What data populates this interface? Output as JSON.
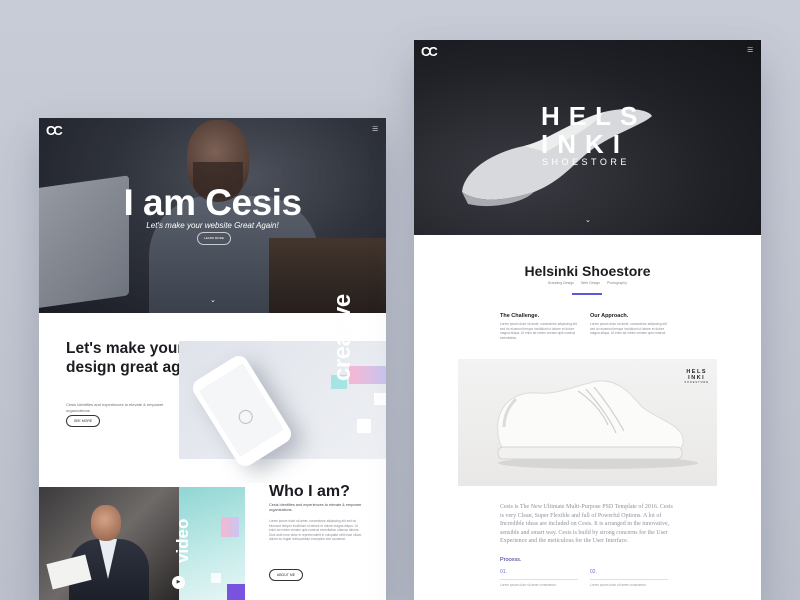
{
  "left_page": {
    "logo": "CC",
    "hero": {
      "title": "I am Cesis",
      "subtitle": "Let's make your website Great Again!",
      "button": "LEARN MORE"
    },
    "section_design": {
      "heading": "Let's make your design great again",
      "description": "Cesis Identifies and experiences to elevate & empower organizations",
      "button": "SEE MORE",
      "creative_word": "creative"
    },
    "section_about": {
      "video_word": "video",
      "heading": "Who I am?",
      "lead": "Cesis Identifies and experiences to elevate & empower organizations.",
      "body": "Lorem ipsum dolor sit amet, consectetur adipiscing elit sed do eiusmod tempor incididunt ut labore et dolore magna aliqua. Ut enim ad minim veniam quis nostrud exercitation ullamco laboris. Duis aute irure dolor in reprehenderit in voluptate velit esse cillum dolore eu fugiat nulla pariatur excepteur sint occaecat.",
      "button": "ABOUT ME"
    }
  },
  "right_page": {
    "logo": "CC",
    "hero": {
      "title_line1": "HELS",
      "title_line2": "INKI",
      "tagline": "SHOESTORE"
    },
    "project": {
      "title": "Helsinki Shoestore",
      "tags": [
        "Branding Design",
        "Web Design",
        "Photography"
      ],
      "challenge_title": "The Challenge.",
      "challenge_text": "Lorem ipsum dolor sit amet, consectetur adipiscing elit sed do eiusmod tempor incididunt ut labore et dolore magna aliqua. Ut enim ad minim veniam quis nostrud exercitation.",
      "approach_title": "Our Approach.",
      "approach_text": "Lorem ipsum dolor sit amet, consectetur adipiscing elit sed do eiusmod tempor incididunt ut labore et dolore magna aliqua. Ut enim ad minim veniam quis nostrud.",
      "mini_logo_line1": "HELS",
      "mini_logo_line2": "INKI",
      "mini_logo_tag": "SHOESTORE",
      "paragraph": "Cesis is The New Ultimate Multi-Purpose PSD Template of 2016. Cesis is very Clean, Super Flexible and full of Powerful Options. A lot of Incredible ideas are included on Cesis. It is arranged in the innovative, sensible and smart way. Cesis is build by strong concerns for the User Experience and the meticulous for the User Interface.",
      "process_title": "Process.",
      "process_steps": [
        {
          "num": "01.",
          "text": "Lorem ipsum dolor sit amet consectetur"
        },
        {
          "num": "02.",
          "text": "Lorem ipsum dolor sit amet consectetur"
        }
      ]
    }
  }
}
